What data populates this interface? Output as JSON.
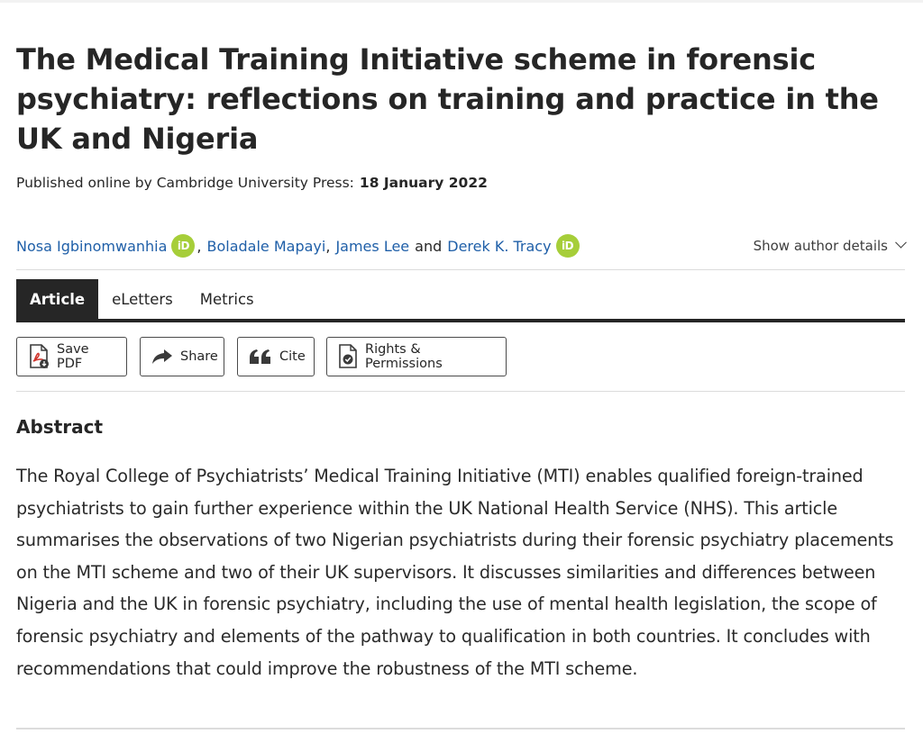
{
  "article": {
    "title": "The Medical Training Initiative scheme in forensic psychiatry: reflections on training and practice in the UK and Nigeria",
    "published_label": "Published online by Cambridge University Press:",
    "published_date": "18 January 2022"
  },
  "authors": {
    "list": [
      {
        "name": "Nosa Igbinomwanhia",
        "orcid": true,
        "orcid_label": "iD"
      },
      {
        "name": "Boladale Mapayi",
        "orcid": false
      },
      {
        "name": "James Lee",
        "orcid": false
      },
      {
        "name": "Derek K. Tracy",
        "orcid": true,
        "orcid_label": "iD"
      }
    ],
    "comma": ",",
    "conjunction": "and",
    "show_details_label": "Show author details"
  },
  "tabs": [
    {
      "label": "Article",
      "active": true
    },
    {
      "label": "eLetters",
      "active": false
    },
    {
      "label": "Metrics",
      "active": false
    }
  ],
  "actions": {
    "save_pdf": "Save PDF",
    "share": "Share",
    "cite": "Cite",
    "rights": "Rights & Permissions"
  },
  "abstract": {
    "heading": "Abstract",
    "text": "The Royal College of Psychiatrists’ Medical Training Initiative (MTI) enables qualified foreign-trained psychiatrists to gain further experience within the UK National Health Service (NHS). This article summarises the observations of two Nigerian psychiatrists during their forensic psychiatry placements on the MTI scheme and two of their UK supervisors. It discusses similarities and differences between Nigeria and the UK in forensic psychiatry, including the use of mental health legislation, the scope of forensic psychiatry and elements of the pathway to qualification in both countries. It concludes with recommendations that could improve the robustness of the MTI scheme."
  },
  "colors": {
    "link": "#1f5fa8",
    "orcid": "#a6ce39",
    "active_tab": "#262626"
  }
}
